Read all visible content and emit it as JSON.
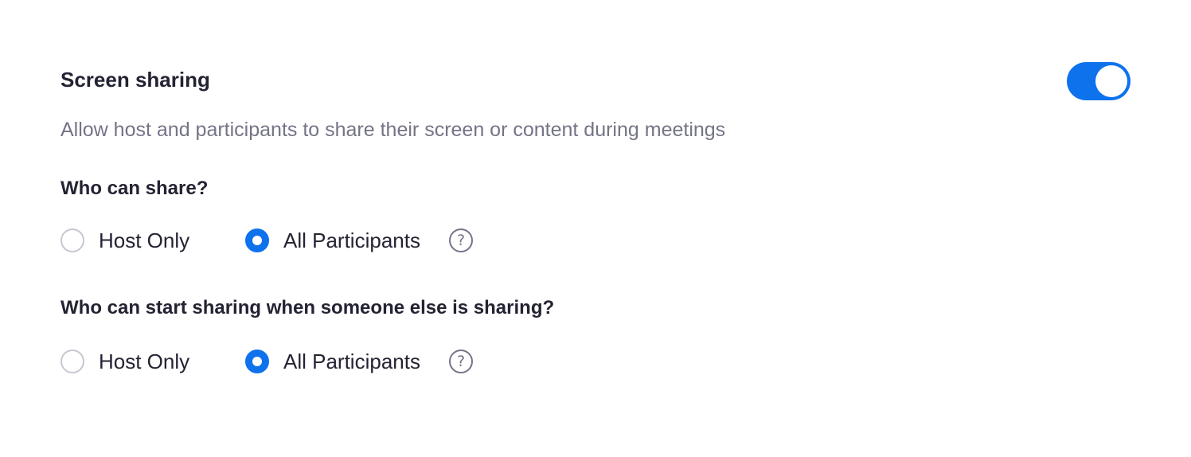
{
  "setting": {
    "title": "Screen sharing",
    "description": "Allow host and participants to share their screen or content during meetings",
    "enabled": true
  },
  "groups": [
    {
      "label": "Who can share?",
      "options": [
        {
          "label": "Host Only",
          "selected": false
        },
        {
          "label": "All Participants",
          "selected": true
        }
      ],
      "help_icon": "question-circle-icon",
      "help_glyph": "?"
    },
    {
      "label": "Who can start sharing when someone else is sharing?",
      "options": [
        {
          "label": "Host Only",
          "selected": false
        },
        {
          "label": "All Participants",
          "selected": true
        }
      ],
      "help_icon": "question-circle-icon",
      "help_glyph": "?"
    }
  ],
  "colors": {
    "accent": "#0e72ed",
    "text": "#232333",
    "muted": "#747487",
    "radio_border": "#c7c7d1"
  }
}
